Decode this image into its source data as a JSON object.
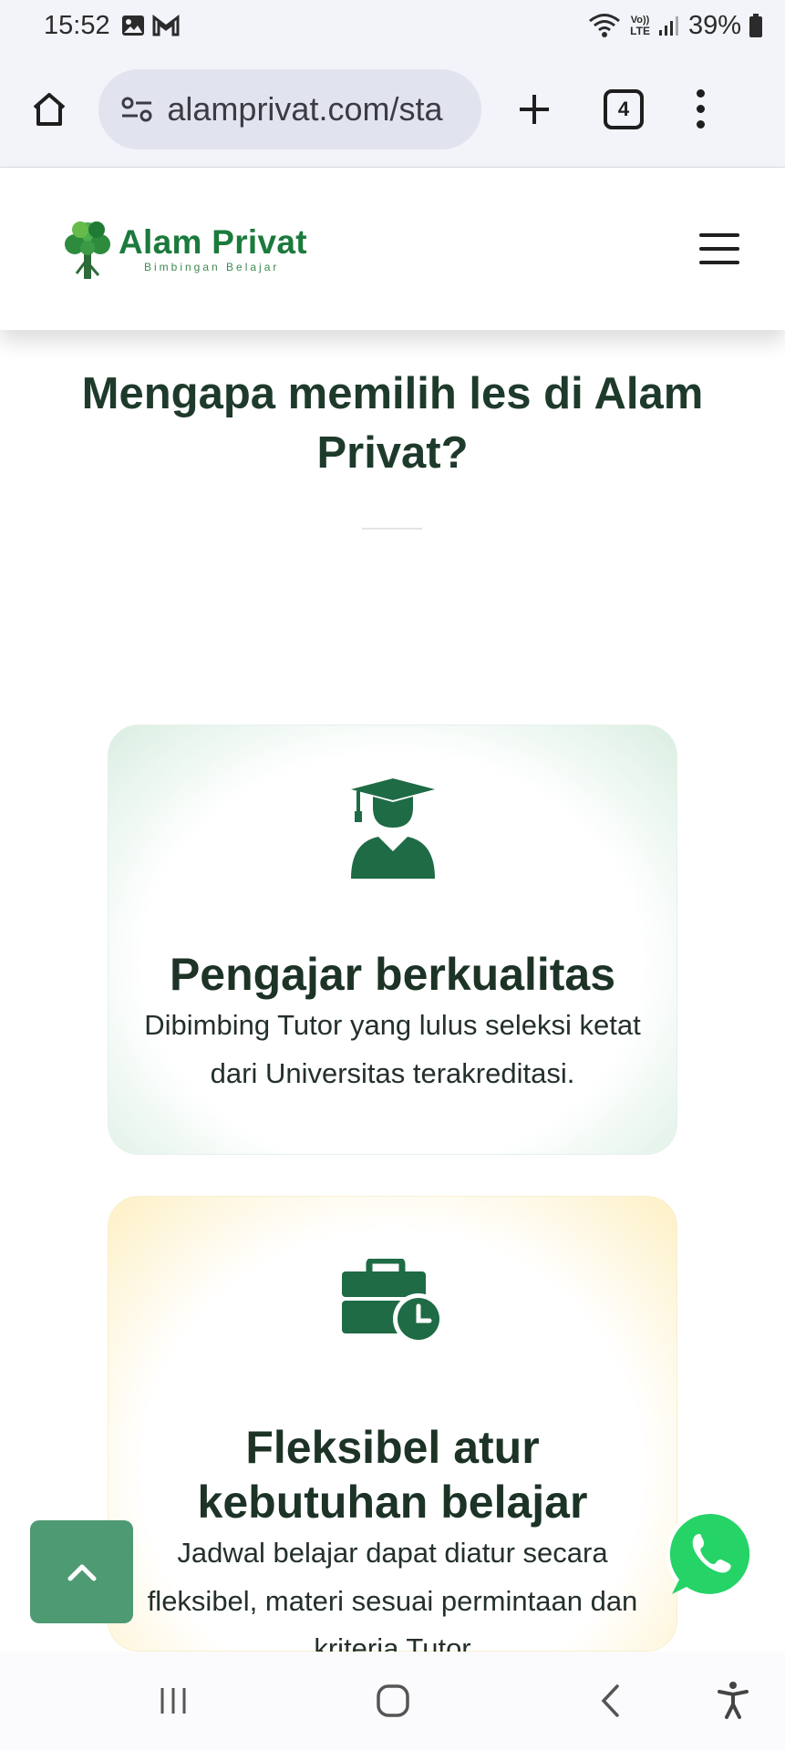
{
  "status_bar": {
    "time": "15:52",
    "battery": "39%",
    "network_label": "LTE",
    "icons": [
      "gallery-icon",
      "gmail-icon",
      "wifi-icon",
      "volte-icon",
      "signal-icon",
      "battery-icon"
    ]
  },
  "browser": {
    "url": "alamprivat.com/sta",
    "tab_count": "4"
  },
  "site": {
    "brand": "Alam Privat",
    "tagline": "Bimbingan Belajar"
  },
  "section": {
    "heading": "Mengapa memilih les di Alam Privat?"
  },
  "cards": [
    {
      "icon": "graduate-icon",
      "title": "Pengajar berkualitas",
      "desc": "Dibimbing Tutor yang lulus seleksi ketat dari Universitas terakreditasi."
    },
    {
      "icon": "briefcase-clock-icon",
      "title": "Fleksibel atur kebutuhan belajar",
      "desc": "Jadwal belajar dapat diatur secara fleksibel, materi sesuai permintaan dan kriteria Tutor"
    }
  ],
  "colors": {
    "brand_green": "#1b7a3c",
    "icon_green": "#1e6b45",
    "back_to_top": "#4e9a73",
    "whatsapp": "#25d366"
  }
}
